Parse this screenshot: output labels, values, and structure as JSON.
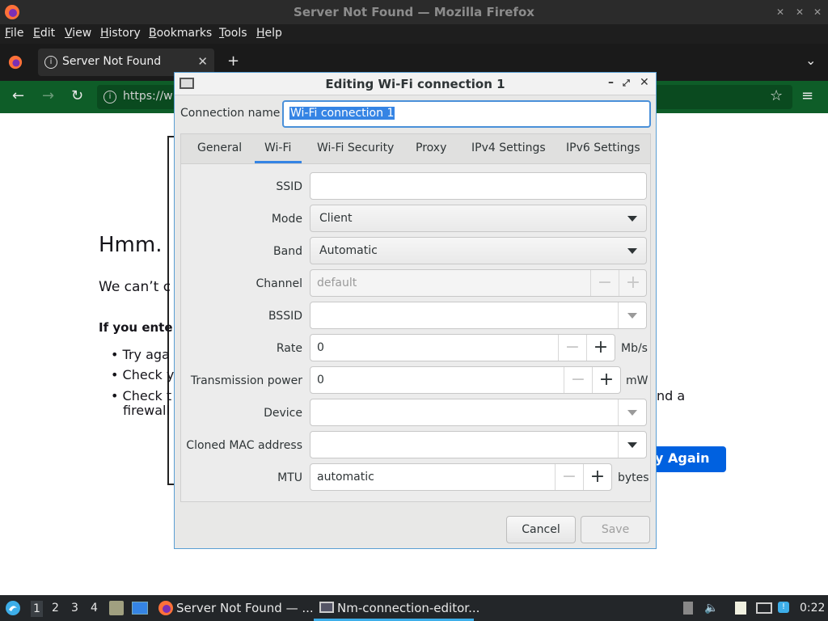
{
  "browser": {
    "window_title": "Server Not Found — Mozilla Firefox",
    "menu": [
      "File",
      "Edit",
      "View",
      "History",
      "Bookmarks",
      "Tools",
      "Help"
    ],
    "tab_title": "Server Not Found",
    "url_partial": "https://w",
    "accent_color": "#0e5d28"
  },
  "error_page": {
    "heading": "Hmm.",
    "text": "We can’t c",
    "bold": "If you ente",
    "items": [
      "Try aga",
      "Check y",
      "Check t"
    ],
    "item3_line2": "firewall",
    "item3_tail": "nd a",
    "try_again": "y Again"
  },
  "dialog": {
    "title": "Editing Wi-Fi connection 1",
    "connection_name_label": "Connection name",
    "connection_name_value": "Wi-Fi connection 1",
    "tabs": [
      "General",
      "Wi-Fi",
      "Wi-Fi Security",
      "Proxy",
      "IPv4 Settings",
      "IPv6 Settings"
    ],
    "active_tab": "Wi-Fi",
    "fields": {
      "ssid": {
        "label": "SSID",
        "value": ""
      },
      "mode": {
        "label": "Mode",
        "value": "Client"
      },
      "band": {
        "label": "Band",
        "value": "Automatic"
      },
      "channel": {
        "label": "Channel",
        "value": "default"
      },
      "bssid": {
        "label": "BSSID",
        "value": ""
      },
      "rate": {
        "label": "Rate",
        "value": "0",
        "unit": "Mb/s"
      },
      "tx_power": {
        "label": "Transmission power",
        "value": "0",
        "unit": "mW"
      },
      "device": {
        "label": "Device",
        "value": ""
      },
      "cloned_mac": {
        "label": "Cloned MAC address",
        "value": ""
      },
      "mtu": {
        "label": "MTU",
        "value": "automatic",
        "unit": "bytes"
      }
    },
    "buttons": {
      "cancel": "Cancel",
      "save": "Save"
    },
    "spin_minus": "−",
    "spin_plus": "+"
  },
  "taskbar": {
    "workspaces": [
      "1",
      "2",
      "3",
      "4"
    ],
    "tasks": [
      "Server Not Found — ...",
      "Nm-connection-editor..."
    ],
    "clock": "0:22"
  }
}
